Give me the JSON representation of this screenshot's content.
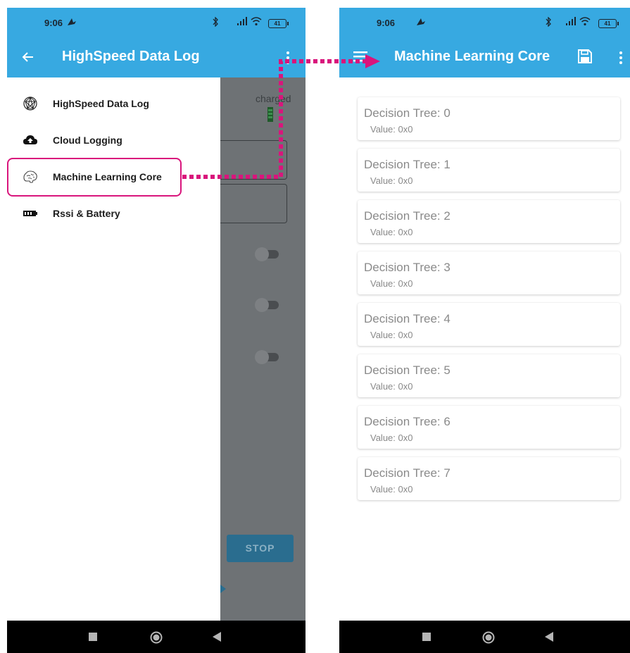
{
  "left_phone": {
    "status": {
      "time": "9:06",
      "battery": "41"
    },
    "appbar": {
      "title": "HighSpeed Data Log",
      "back_icon": "arrow-left-icon",
      "menu_icon": "more-vert-icon"
    },
    "drawer": {
      "items": [
        {
          "label": "HighSpeed Data Log",
          "icon": "network-sphere-icon"
        },
        {
          "label": "Cloud Logging",
          "icon": "cloud-upload-icon"
        },
        {
          "label": "Machine Learning Core",
          "icon": "brain-icon"
        },
        {
          "label": "Rssi & Battery",
          "icon": "battery-icon"
        }
      ]
    },
    "background": {
      "charged_label": "charged",
      "stop_label": "STOP"
    }
  },
  "right_phone": {
    "status": {
      "time": "9:06",
      "battery": "41"
    },
    "appbar": {
      "title": "Machine Learning Core",
      "menu_icon": "hamburger-menu-icon",
      "save_icon": "save-icon",
      "overflow_icon": "more-vert-icon"
    },
    "trees": [
      {
        "title": "Decision Tree: 0",
        "value": "Value: 0x0"
      },
      {
        "title": "Decision Tree: 1",
        "value": "Value: 0x0"
      },
      {
        "title": "Decision Tree: 2",
        "value": "Value: 0x0"
      },
      {
        "title": "Decision Tree: 3",
        "value": "Value: 0x0"
      },
      {
        "title": "Decision Tree: 4",
        "value": "Value: 0x0"
      },
      {
        "title": "Decision Tree: 5",
        "value": "Value: 0x0"
      },
      {
        "title": "Decision Tree: 6",
        "value": "Value: 0x0"
      },
      {
        "title": "Decision Tree: 7",
        "value": "Value: 0x0"
      }
    ]
  },
  "colors": {
    "appbar": "#37a9e1",
    "highlight": "#d9157c",
    "stop_button": "#2a6d8f"
  }
}
